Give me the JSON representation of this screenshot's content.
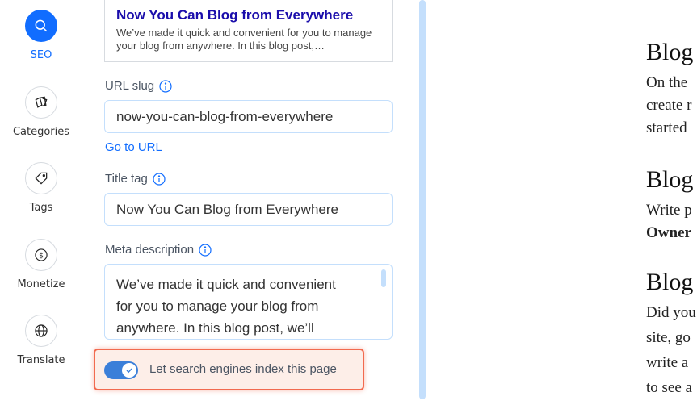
{
  "sidebar": {
    "items": [
      {
        "label": "SEO",
        "icon": "search-icon",
        "active": true
      },
      {
        "label": "Categories",
        "icon": "categories-icon"
      },
      {
        "label": "Tags",
        "icon": "tag-icon"
      },
      {
        "label": "Monetize",
        "icon": "dollar-icon"
      },
      {
        "label": "Translate",
        "icon": "globe-icon"
      }
    ]
  },
  "seo_panel": {
    "preview": {
      "title": "Now You Can Blog from Everywhere",
      "description": "We’ve made it quick and convenient for you to manage your blog from anywhere. In this blog post,…"
    },
    "url_slug": {
      "label": "URL slug",
      "value": "now-you-can-blog-from-everywhere"
    },
    "go_to_url": "Go to URL",
    "title_tag": {
      "label": "Title tag",
      "value": "Now You Can Blog from Everywhere"
    },
    "meta_description": {
      "label": "Meta description",
      "lines": [
        "We’ve made it quick and convenient",
        "for you to manage your blog from",
        "anywhere. In this blog post, we’ll"
      ]
    },
    "index_toggle": {
      "label": "Let search engines index this page",
      "on": true
    }
  },
  "blog_content": {
    "sections": [
      {
        "heading": "Blog",
        "lines": [
          "On the",
          "create r",
          "started"
        ]
      },
      {
        "heading": "Blog",
        "lines": [
          "Write p",
          "Owner"
        ]
      },
      {
        "heading": "Blog",
        "lines": [
          "Did you",
          "site, go",
          "write a",
          "to see a"
        ]
      }
    ]
  },
  "colors": {
    "accent": "#116dff",
    "highlight_border": "#f26a4f",
    "input_border": "#c4dffc",
    "preview_title": "#1a0dab"
  }
}
